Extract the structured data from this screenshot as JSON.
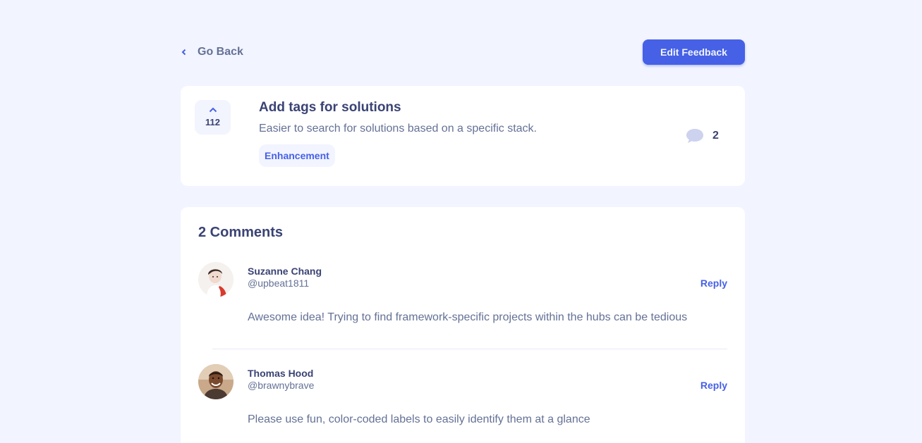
{
  "nav": {
    "back_label": "Go Back",
    "edit_label": "Edit Feedback"
  },
  "feedback": {
    "upvotes": "112",
    "title": "Add tags for solutions",
    "description": "Easier to search for solutions based on a specific stack.",
    "tag": "Enhancement",
    "comment_count": "2"
  },
  "comments_section": {
    "heading": "2 Comments",
    "comments": [
      {
        "name": "Suzanne Chang",
        "handle": "@upbeat1811",
        "reply_label": "Reply",
        "text": "Awesome idea! Trying to find framework-specific projects within the hubs can be tedious"
      },
      {
        "name": "Thomas Hood",
        "handle": "@brawnybrave",
        "reply_label": "Reply",
        "text": "Please use fun, color-coded labels to easily identify them at a glance"
      }
    ]
  },
  "colors": {
    "background": "#f2f4ff",
    "accent": "#4661e6",
    "heading": "#3a4374",
    "body_text": "#647196",
    "card": "#ffffff"
  },
  "icons": [
    "chevron-left-icon",
    "chevron-up-icon",
    "comment-bubble-icon"
  ]
}
